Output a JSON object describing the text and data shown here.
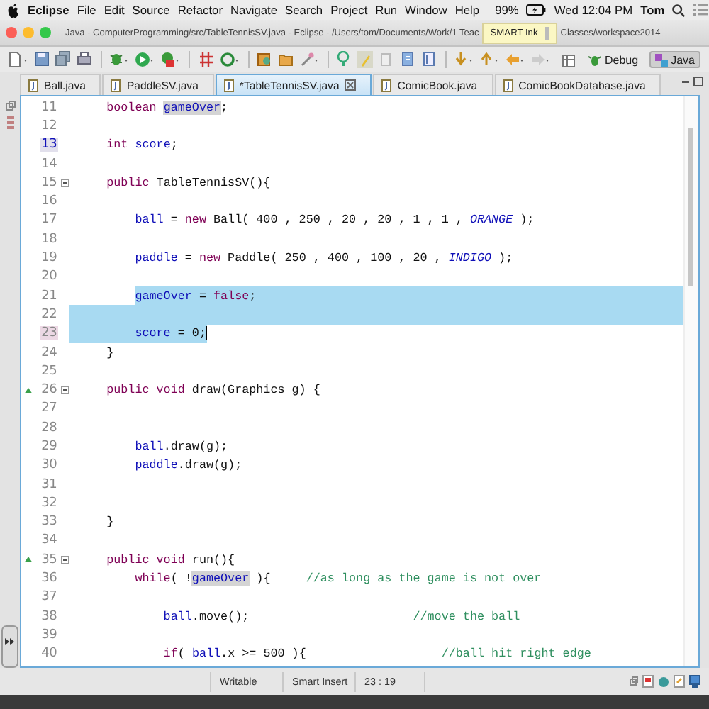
{
  "menu_bar": {
    "app": "Eclipse",
    "menus": [
      "File",
      "Edit",
      "Source",
      "Refactor",
      "Navigate",
      "Search",
      "Project",
      "Run",
      "Window",
      "Help"
    ],
    "battery": "99%",
    "clock": "Wed 12:04 PM",
    "user": "Tom"
  },
  "window": {
    "title_parts": [
      "Java - ComputerProgramming/src/TableTennisSV.java - Eclipse - /Users/tom/Documents/Work/1 Teac",
      "Classes/workspace2014"
    ]
  },
  "tooltip": {
    "label": "SMART Ink"
  },
  "perspectives": [
    {
      "label": "Debug",
      "selected": false
    },
    {
      "label": "Java",
      "selected": true
    }
  ],
  "tabs": [
    {
      "label": "Ball.java",
      "selected": false
    },
    {
      "label": "PaddleSV.java",
      "selected": false
    },
    {
      "label": "*TableTennisSV.java",
      "selected": true
    },
    {
      "label": "ComicBook.java",
      "selected": false
    },
    {
      "label": "ComicBookDatabase.java",
      "selected": false
    }
  ],
  "editor": {
    "lines": [
      {
        "number": "11",
        "occurrence": false,
        "current": false,
        "selected": false,
        "fold": false,
        "override": false,
        "tokens": [
          {
            "kind": "keyword",
            "text": "    boolean "
          },
          {
            "kind": "occurrence",
            "text": "gameOver"
          },
          {
            "kind": "plain",
            "text": ";"
          }
        ]
      },
      {
        "number": "12",
        "occurrence": false,
        "current": false,
        "selected": false,
        "fold": false,
        "override": false
      },
      {
        "number": "13",
        "occurrence": true,
        "current": false,
        "selected": false,
        "fold": false,
        "override": false,
        "tokens": [
          {
            "kind": "keyword",
            "text": "    int "
          },
          {
            "kind": "field",
            "text": "score"
          },
          {
            "kind": "plain",
            "text": ";"
          }
        ]
      },
      {
        "number": "14",
        "occurrence": false,
        "current": false,
        "selected": false,
        "fold": false,
        "override": false
      },
      {
        "number": "15",
        "occurrence": false,
        "current": false,
        "selected": false,
        "fold": true,
        "override": false,
        "tokens": [
          {
            "kind": "keyword",
            "text": "    public"
          },
          {
            "kind": "plain",
            "text": " TableTennisSV(){"
          }
        ]
      },
      {
        "number": "16",
        "occurrence": false,
        "current": false,
        "selected": false,
        "fold": false,
        "override": false
      },
      {
        "number": "17",
        "occurrence": false,
        "current": false,
        "selected": false,
        "fold": false,
        "override": false,
        "tokens": [
          {
            "kind": "field",
            "text": "        ball"
          },
          {
            "kind": "plain",
            "text": " = "
          },
          {
            "kind": "keyword",
            "text": "new"
          },
          {
            "kind": "plain",
            "text": " Ball( 400 , 250 , 20 , 20 , 1 , 1 , "
          },
          {
            "kind": "constant",
            "text": "ORANGE"
          },
          {
            "kind": "plain",
            "text": " );"
          }
        ]
      },
      {
        "number": "18",
        "occurrence": false,
        "current": false,
        "selected": false,
        "fold": false,
        "override": false
      },
      {
        "number": "19",
        "occurrence": false,
        "current": false,
        "selected": false,
        "fold": false,
        "override": false,
        "tokens": [
          {
            "kind": "field",
            "text": "        paddle"
          },
          {
            "kind": "plain",
            "text": " = "
          },
          {
            "kind": "keyword",
            "text": "new"
          },
          {
            "kind": "plain",
            "text": " Paddle( 250 , 400 , 100 , 20 , "
          },
          {
            "kind": "constant",
            "text": "INDIGO"
          },
          {
            "kind": "plain",
            "text": " );"
          }
        ]
      },
      {
        "number": "20",
        "occurrence": false,
        "current": false,
        "selected": false,
        "fold": false,
        "override": false
      },
      {
        "number": "21",
        "occurrence": false,
        "current": false,
        "selected": true,
        "fold": false,
        "override": false,
        "tokens": [
          {
            "kind": "field",
            "text": "        gameOver"
          },
          {
            "kind": "plain",
            "text": " = "
          },
          {
            "kind": "keyword",
            "text": "false"
          },
          {
            "kind": "plain",
            "text": ";"
          }
        ]
      },
      {
        "number": "22",
        "occurrence": false,
        "current": false,
        "selected": true,
        "fold": false,
        "override": false
      },
      {
        "number": "23",
        "occurrence": false,
        "current": true,
        "selected": true,
        "fold": false,
        "override": false,
        "tokens": [
          {
            "kind": "field",
            "text": "        score"
          },
          {
            "kind": "plain",
            "text": " = 0;"
          }
        ]
      },
      {
        "number": "24",
        "occurrence": false,
        "current": false,
        "selected": false,
        "fold": false,
        "override": false,
        "tokens": [
          {
            "kind": "plain",
            "text": "    }"
          }
        ]
      },
      {
        "number": "25",
        "occurrence": false,
        "current": false,
        "selected": false,
        "fold": false,
        "override": false
      },
      {
        "number": "26",
        "occurrence": false,
        "current": false,
        "selected": false,
        "fold": true,
        "override": true,
        "tokens": [
          {
            "kind": "keyword",
            "text": "    public void"
          },
          {
            "kind": "plain",
            "text": " draw(Graphics g) {"
          }
        ]
      },
      {
        "number": "27",
        "occurrence": false,
        "current": false,
        "selected": false,
        "fold": false,
        "override": false
      },
      {
        "number": "28",
        "occurrence": false,
        "current": false,
        "selected": false,
        "fold": false,
        "override": false
      },
      {
        "number": "29",
        "occurrence": false,
        "current": false,
        "selected": false,
        "fold": false,
        "override": false,
        "tokens": [
          {
            "kind": "field",
            "text": "        ball"
          },
          {
            "kind": "plain",
            "text": ".draw(g);"
          }
        ]
      },
      {
        "number": "30",
        "occurrence": false,
        "current": false,
        "selected": false,
        "fold": false,
        "override": false,
        "tokens": [
          {
            "kind": "field",
            "text": "        paddle"
          },
          {
            "kind": "plain",
            "text": ".draw(g);"
          }
        ]
      },
      {
        "number": "31",
        "occurrence": false,
        "current": false,
        "selected": false,
        "fold": false,
        "override": false
      },
      {
        "number": "32",
        "occurrence": false,
        "current": false,
        "selected": false,
        "fold": false,
        "override": false
      },
      {
        "number": "33",
        "occurrence": false,
        "current": false,
        "selected": false,
        "fold": false,
        "override": false,
        "tokens": [
          {
            "kind": "plain",
            "text": "    }"
          }
        ]
      },
      {
        "number": "34",
        "occurrence": false,
        "current": false,
        "selected": false,
        "fold": false,
        "override": false
      },
      {
        "number": "35",
        "occurrence": false,
        "current": false,
        "selected": false,
        "fold": true,
        "override": true,
        "tokens": [
          {
            "kind": "keyword",
            "text": "    public void"
          },
          {
            "kind": "plain",
            "text": " run(){"
          }
        ]
      },
      {
        "number": "36",
        "occurrence": false,
        "current": false,
        "selected": false,
        "fold": false,
        "override": false,
        "tokens": [
          {
            "kind": "keyword",
            "text": "        while"
          },
          {
            "kind": "plain",
            "text": "( !"
          },
          {
            "kind": "occurrence",
            "text": "gameOver"
          },
          {
            "kind": "plain",
            "text": " ){     "
          },
          {
            "kind": "comment",
            "text": "//as long as the game is not over"
          }
        ]
      },
      {
        "number": "37",
        "occurrence": false,
        "current": false,
        "selected": false,
        "fold": false,
        "override": false
      },
      {
        "number": "38",
        "occurrence": false,
        "current": false,
        "selected": false,
        "fold": false,
        "override": false,
        "tokens": [
          {
            "kind": "field",
            "text": "            ball"
          },
          {
            "kind": "plain",
            "text": ".move();                       "
          },
          {
            "kind": "comment",
            "text": "//move the ball"
          }
        ]
      },
      {
        "number": "39",
        "occurrence": false,
        "current": false,
        "selected": false,
        "fold": false,
        "override": false
      },
      {
        "number": "40",
        "occurrence": false,
        "current": false,
        "selected": false,
        "fold": false,
        "override": false,
        "tokens": [
          {
            "kind": "keyword",
            "text": "            if"
          },
          {
            "kind": "plain",
            "text": "( "
          },
          {
            "kind": "field",
            "text": "ball"
          },
          {
            "kind": "plain",
            "text": ".x >= 500 ){                   "
          },
          {
            "kind": "comment",
            "text": "//ball hit right edge"
          }
        ]
      }
    ]
  },
  "status_bar": {
    "fields": [
      "Writable",
      "Smart Insert",
      "23 : 19"
    ]
  }
}
